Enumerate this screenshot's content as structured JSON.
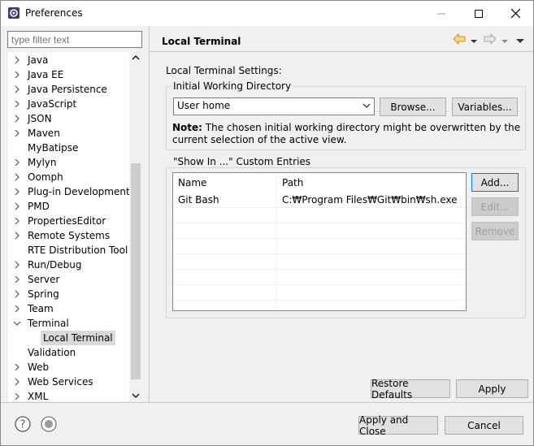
{
  "window": {
    "title": "Preferences",
    "icons": {
      "app": "preferences-app-icon",
      "minimize": "minimize-icon",
      "maximize": "maximize-icon",
      "close": "close-icon"
    }
  },
  "filter": {
    "placeholder": "type filter text"
  },
  "tree": {
    "items": [
      {
        "label": "Java",
        "expandable": true
      },
      {
        "label": "Java EE",
        "expandable": true
      },
      {
        "label": "Java Persistence",
        "expandable": true
      },
      {
        "label": "JavaScript",
        "expandable": true
      },
      {
        "label": "JSON",
        "expandable": true
      },
      {
        "label": "Maven",
        "expandable": true
      },
      {
        "label": "MyBatipse",
        "expandable": false
      },
      {
        "label": "Mylyn",
        "expandable": true
      },
      {
        "label": "Oomph",
        "expandable": true
      },
      {
        "label": "Plug-in Development",
        "expandable": true
      },
      {
        "label": "PMD",
        "expandable": true
      },
      {
        "label": "PropertiesEditor",
        "expandable": true
      },
      {
        "label": "Remote Systems",
        "expandable": true
      },
      {
        "label": "RTE Distribution Tool",
        "expandable": false
      },
      {
        "label": "Run/Debug",
        "expandable": true
      },
      {
        "label": "Server",
        "expandable": true
      },
      {
        "label": "Spring",
        "expandable": true
      },
      {
        "label": "Team",
        "expandable": true
      },
      {
        "label": "Terminal",
        "expandable": true,
        "expanded": true
      },
      {
        "label": "Local Terminal",
        "child": true,
        "selected": true
      },
      {
        "label": "Validation",
        "expandable": false
      },
      {
        "label": "Web",
        "expandable": true
      },
      {
        "label": "Web Services",
        "expandable": true
      },
      {
        "label": "XML",
        "expandable": true
      }
    ]
  },
  "page": {
    "title": "Local Terminal",
    "settings_label": "Local Terminal Settings:",
    "initial_dir": {
      "group_title": "Initial Working Directory",
      "combo_value": "User home",
      "browse_label": "Browse...",
      "variables_label": "Variables...",
      "note_label": "Note:",
      "note_text": "The chosen initial working directory might be overwritten by the current selection of the active view."
    },
    "show_in": {
      "group_title": "\"Show In ...\" Custom Entries",
      "columns": [
        "Name",
        "Path"
      ],
      "rows": [
        {
          "name": "Git Bash",
          "path": "C:₩Program Files₩Git₩bin₩sh.exe"
        }
      ],
      "add_label": "Add...",
      "edit_label": "Edit...",
      "remove_label": "Remove"
    },
    "restore_defaults_label": "Restore Defaults",
    "apply_label": "Apply"
  },
  "footer": {
    "help_icon": "help-icon",
    "import_export_icon": "import-export-icon",
    "apply_close_label": "Apply and Close",
    "cancel_label": "Cancel"
  }
}
